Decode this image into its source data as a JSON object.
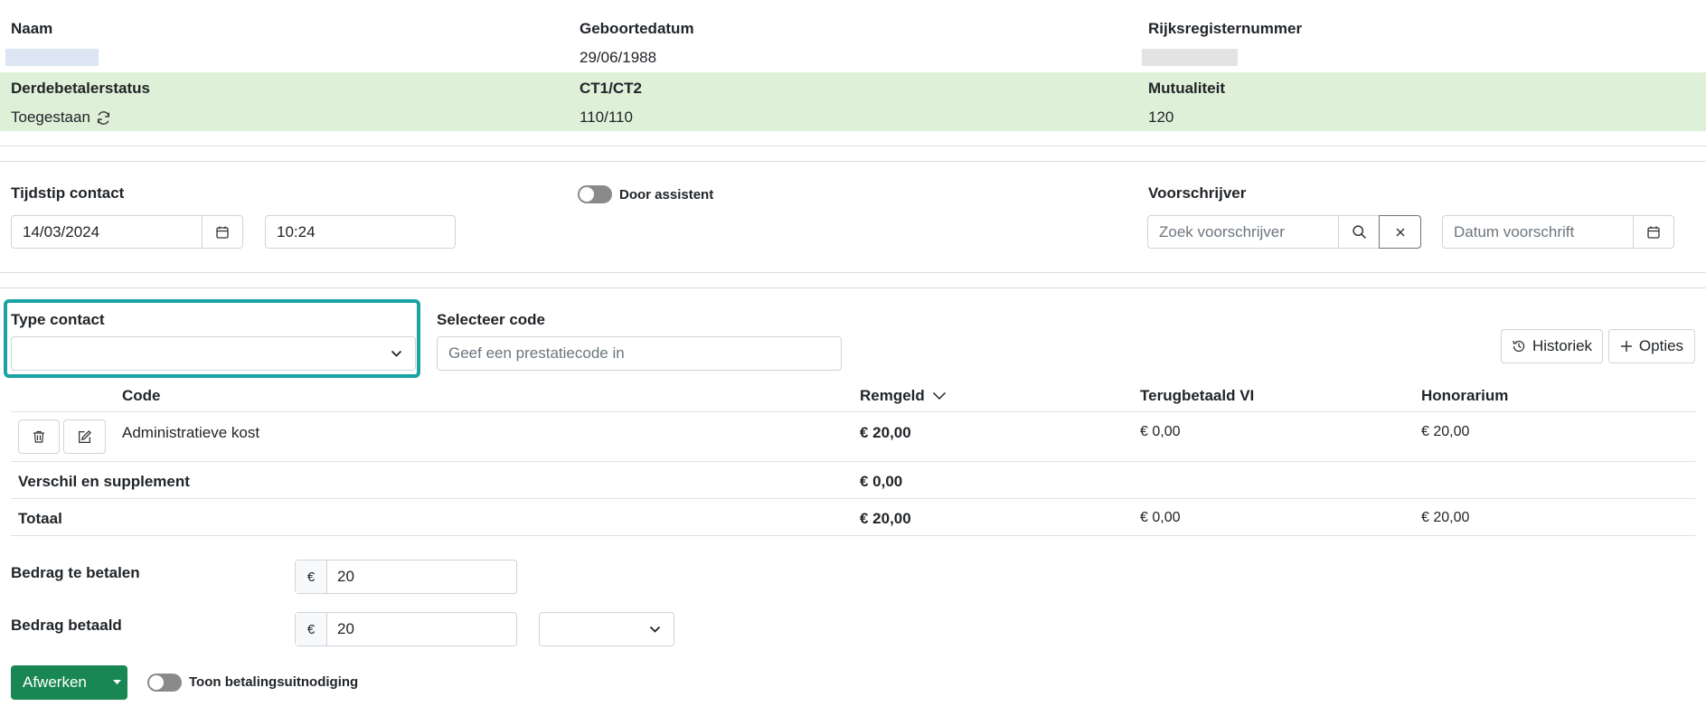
{
  "patient": {
    "name_label": "Naam",
    "birthdate_label": "Geboortedatum",
    "birthdate_value": "29/06/1988",
    "rrn_label": "Rijksregisternummer",
    "third_party_label": "Derdebetalerstatus",
    "third_party_value": "Toegestaan",
    "ct_label": "CT1/CT2",
    "ct_value": "110/110",
    "mutuality_label": "Mutualiteit",
    "mutuality_value": "120"
  },
  "contact": {
    "time_label": "Tijdstip contact",
    "date_value": "14/03/2024",
    "time_value": "10:24",
    "assistant_label": "Door assistent",
    "prescriber_label": "Voorschrijver",
    "prescriber_placeholder": "Zoek voorschrijver",
    "prescription_date_placeholder": "Datum voorschrift"
  },
  "codes": {
    "type_label": "Type contact",
    "type_value": "",
    "select_code_label": "Selecteer code",
    "select_code_placeholder": "Geef een prestatiecode in",
    "history_button": "Historiek",
    "options_button": "Opties"
  },
  "table": {
    "headers": {
      "code": "Code",
      "remgeld": "Remgeld",
      "refund": "Terugbetaald VI",
      "fee": "Honorarium"
    },
    "rows": [
      {
        "code": "Administratieve kost",
        "remgeld": "€ 20,00",
        "refund": "€ 0,00",
        "fee": "€ 20,00"
      }
    ],
    "supplement": {
      "label": "Verschil en supplement",
      "remgeld": "€ 0,00"
    },
    "total": {
      "label": "Totaal",
      "remgeld": "€ 20,00",
      "refund": "€ 0,00",
      "fee": "€ 20,00"
    }
  },
  "payment": {
    "to_pay_label": "Bedrag te betalen",
    "to_pay_value": "20",
    "paid_label": "Bedrag betaald",
    "paid_value": "20",
    "currency": "€",
    "method_value": ""
  },
  "footer": {
    "finish_button": "Afwerken",
    "show_invitation_label": "Toon betalingsuitnodiging"
  },
  "colors": {
    "band": "#dff0d8",
    "highlight": "#1aa3a3",
    "primary": "#198754"
  }
}
